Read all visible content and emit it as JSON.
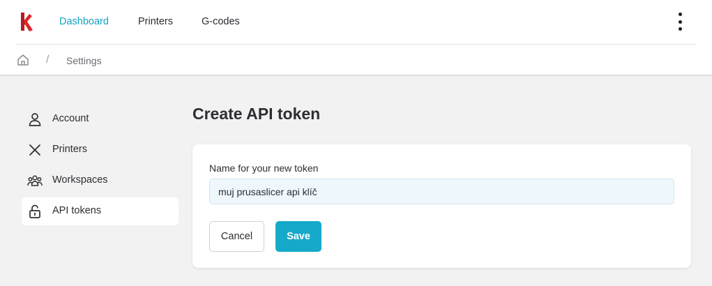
{
  "nav": {
    "links": [
      {
        "label": "Dashboard",
        "active": true
      },
      {
        "label": "Printers",
        "active": false
      },
      {
        "label": "G-codes",
        "active": false
      }
    ]
  },
  "breadcrumb": {
    "separator": "/",
    "current": "Settings"
  },
  "sidebar": {
    "items": [
      {
        "label": "Account",
        "icon": "user-icon",
        "active": false
      },
      {
        "label": "Printers",
        "icon": "close-icon",
        "active": false
      },
      {
        "label": "Workspaces",
        "icon": "people-icon",
        "active": false
      },
      {
        "label": "API tokens",
        "icon": "lock-open-icon",
        "active": true
      }
    ]
  },
  "main": {
    "title": "Create API token",
    "form": {
      "field_label": "Name for your new token",
      "token_name_value": "muj prusaslicer api klíč",
      "cancel_label": "Cancel",
      "save_label": "Save"
    }
  },
  "colors": {
    "accent": "#17a9c9",
    "nav_active": "#13a3c1",
    "logo": "#d9262a",
    "page_bg": "#f2f2f2",
    "input_bg": "#eef8fc"
  }
}
